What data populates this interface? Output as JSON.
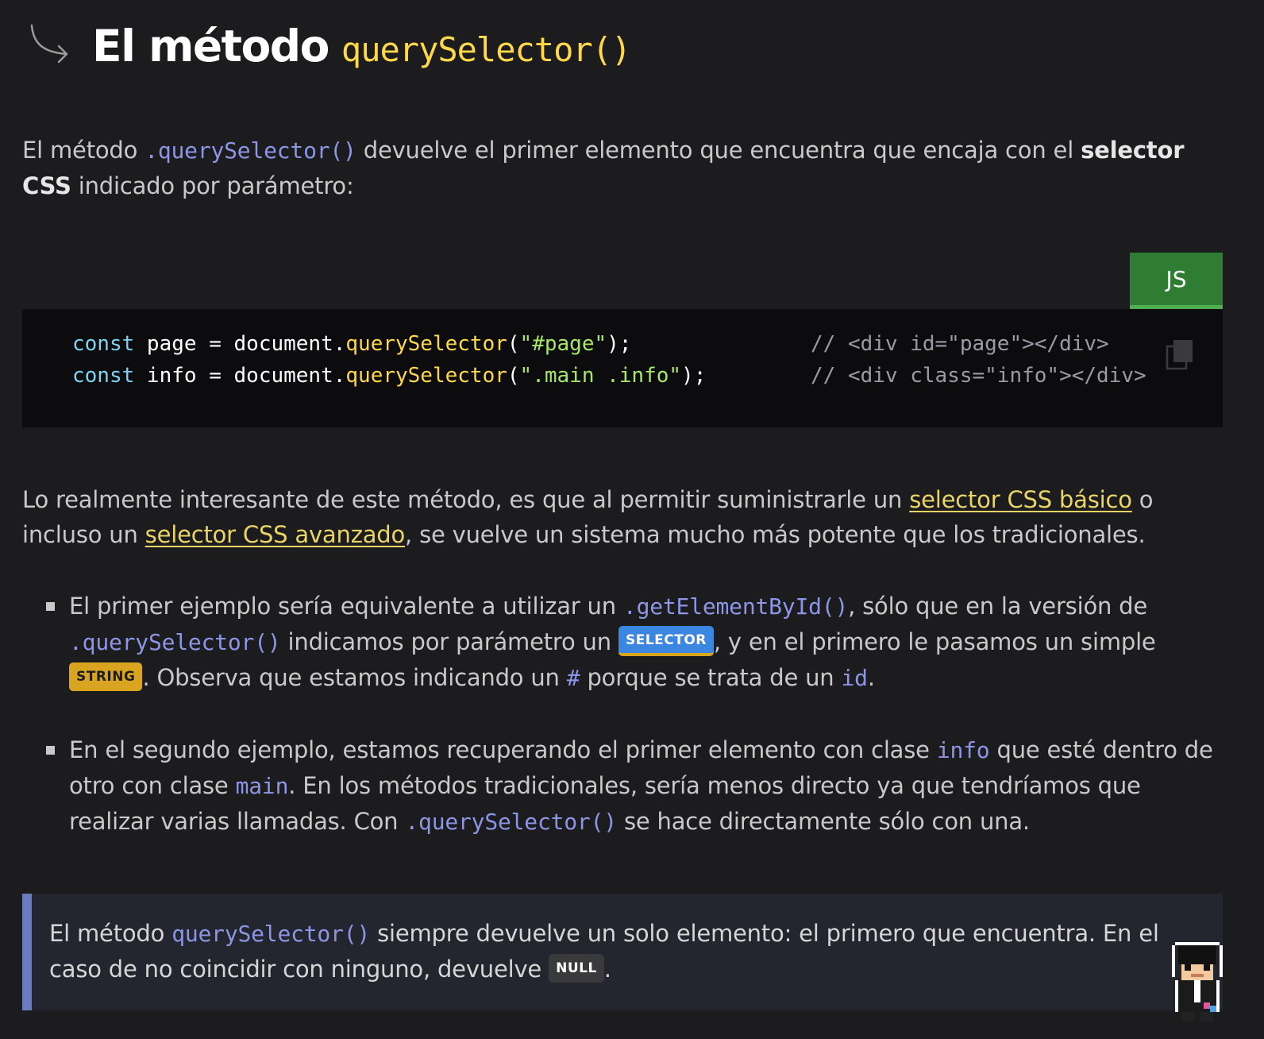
{
  "heading": {
    "title": "El método",
    "code": "querySelector()"
  },
  "intro": {
    "part1": "El método ",
    "method": ".querySelector()",
    "part2": " devuelve el primer elemento que encuentra que encaja con el ",
    "bold": "selector CSS",
    "part3": " indicado por parámetro:"
  },
  "code_block": {
    "language_tab": "JS",
    "lines": [
      {
        "kw": "const",
        "text1": " page = document.",
        "fn": "querySelector",
        "p1": "(",
        "str": "\"#page\"",
        "p2": ");",
        "comment": "// <div id=\"page\"></div>"
      },
      {
        "kw": "const",
        "text1": " info = document.",
        "fn": "querySelector",
        "p1": "(",
        "str": "\".main .info\"",
        "p2": ");",
        "comment": "// <div class=\"info\"></div>"
      }
    ]
  },
  "paragraph2": {
    "part1": "Lo realmente interesante de este método, es que al permitir suministrarle un ",
    "link1": "selector CSS básico",
    "part2": " o incluso un ",
    "link2": "selector CSS avanzado",
    "part3": ", se vuelve un sistema mucho más potente que los tradicionales."
  },
  "bullets": [
    {
      "t1": "El primer ejemplo sería equivalente a utilizar un ",
      "m1": ".getElementById()",
      "t2": ", sólo que en la versión de ",
      "m2": ".querySelector()",
      "t3": " indicamos por parámetro un ",
      "badge1": "SELECTOR",
      "t4": ", y en el primero le pasamos un simple ",
      "badge2": "STRING",
      "t5": ". Observa que estamos indicando un ",
      "m3": "#",
      "t6": " porque se trata de un ",
      "m4": "id",
      "t7": "."
    },
    {
      "t1": "En el segundo ejemplo, estamos recuperando el primer elemento con clase ",
      "m1": "info",
      "t2": " que esté dentro de otro con clase ",
      "m2": "main",
      "t3": ". En los métodos tradicionales, sería menos directo ya que tendríamos que realizar varias llamadas. Con ",
      "m3": ".querySelector()",
      "t4": " se hace directamente sólo con una."
    }
  ],
  "note": {
    "t1": "El método ",
    "m1": "querySelector()",
    "t2": " siempre devuelve un solo elemento: el primero que encuentra. En el caso de no coincidir con ninguno, devuelve ",
    "badge": "NULL",
    "t3": "."
  },
  "colors": {
    "background": "#1c1c1e",
    "heading_code": "#ffd84a",
    "method": "#8c95e6",
    "link": "#e9d566",
    "js_tab": "#2e7d32",
    "badge_selector": "#3b86e0",
    "badge_string": "#d9a521",
    "note_border": "#6b7bbf"
  },
  "icons": {
    "heading": "curved-arrow-icon",
    "code": "copy-icon",
    "avatar": "pixel-avatar"
  }
}
